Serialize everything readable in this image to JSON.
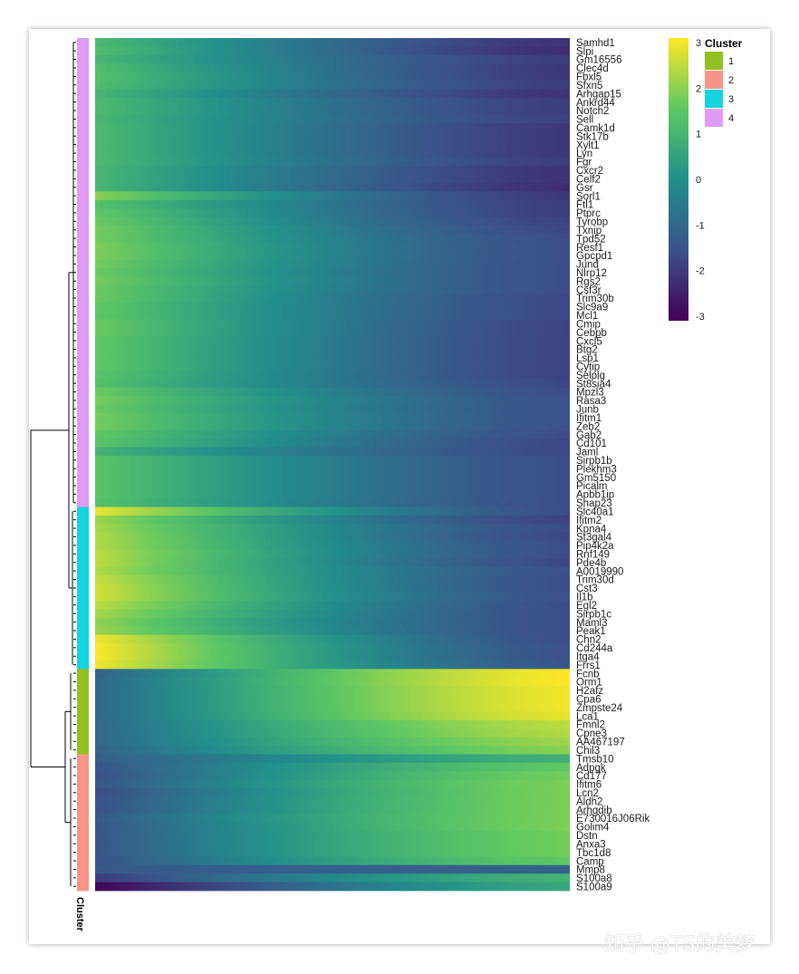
{
  "chart_data": {
    "type": "heatmap",
    "title": "",
    "xlabel": "",
    "ylabel": "",
    "colorbar": {
      "ticks": [
        "3",
        "2",
        "1",
        "0",
        "-1",
        "-2",
        "-3"
      ],
      "range": [
        -3,
        3
      ],
      "colors": [
        "#440154",
        "#3b528b",
        "#21908c",
        "#5dc863",
        "#fde725"
      ]
    },
    "cluster_legend": {
      "title": "Cluster",
      "entries": [
        {
          "label": "1",
          "color": "#93c01f"
        },
        {
          "label": "2",
          "color": "#f8938a"
        },
        {
          "label": "3",
          "color": "#13d4df"
        },
        {
          "label": "4",
          "color": "#df9cf2"
        }
      ]
    },
    "cluster_axis_label": "Cluster",
    "rows": [
      {
        "gene": "Samhd1",
        "cluster": "4",
        "start": 1.1,
        "end": -2.1
      },
      {
        "gene": "Slpi",
        "cluster": "4",
        "start": 1.2,
        "end": -2.2
      },
      {
        "gene": "Gm16556",
        "cluster": "4",
        "start": 1.0,
        "end": -1.9
      },
      {
        "gene": "Clec4d",
        "cluster": "4",
        "start": 1.2,
        "end": -2.0
      },
      {
        "gene": "Fbxl5",
        "cluster": "4",
        "start": 1.3,
        "end": -2.0
      },
      {
        "gene": "Sfxn5",
        "cluster": "4",
        "start": 1.2,
        "end": -1.9
      },
      {
        "gene": "Arhgap15",
        "cluster": "4",
        "start": 1.0,
        "end": -2.1
      },
      {
        "gene": "Ankrd44",
        "cluster": "4",
        "start": 1.1,
        "end": -1.9
      },
      {
        "gene": "Notch2",
        "cluster": "4",
        "start": 1.1,
        "end": -1.9
      },
      {
        "gene": "Sell",
        "cluster": "4",
        "start": 1.0,
        "end": -1.8
      },
      {
        "gene": "Camk1d",
        "cluster": "4",
        "start": 1.1,
        "end": -2.0
      },
      {
        "gene": "Stk17b",
        "cluster": "4",
        "start": 1.1,
        "end": -2.0
      },
      {
        "gene": "Xylt1",
        "cluster": "4",
        "start": 1.1,
        "end": -2.0
      },
      {
        "gene": "Lyn",
        "cluster": "4",
        "start": 1.1,
        "end": -2.0
      },
      {
        "gene": "Fgr",
        "cluster": "4",
        "start": 1.1,
        "end": -1.9
      },
      {
        "gene": "Cxcr2",
        "cluster": "4",
        "start": 1.0,
        "end": -2.1
      },
      {
        "gene": "Celf2",
        "cluster": "4",
        "start": 1.0,
        "end": -2.1
      },
      {
        "gene": "Gsr",
        "cluster": "4",
        "start": 1.0,
        "end": -2.2
      },
      {
        "gene": "Sorl1",
        "cluster": "4",
        "start": 1.9,
        "end": -2.0
      },
      {
        "gene": "Ftl1",
        "cluster": "4",
        "start": 1.3,
        "end": -1.9
      },
      {
        "gene": "Ptprc",
        "cluster": "4",
        "start": 1.5,
        "end": -1.9
      },
      {
        "gene": "Tyrobp",
        "cluster": "4",
        "start": 1.6,
        "end": -1.8
      },
      {
        "gene": "Txnip",
        "cluster": "4",
        "start": 1.7,
        "end": -1.7
      },
      {
        "gene": "Tpd52",
        "cluster": "4",
        "start": 1.7,
        "end": -1.6
      },
      {
        "gene": "Resf1",
        "cluster": "4",
        "start": 1.8,
        "end": -1.6
      },
      {
        "gene": "Gpcpd1",
        "cluster": "4",
        "start": 1.8,
        "end": -1.6
      },
      {
        "gene": "Jund",
        "cluster": "4",
        "start": 1.7,
        "end": -1.6
      },
      {
        "gene": "Nlrp12",
        "cluster": "4",
        "start": 1.6,
        "end": -1.6
      },
      {
        "gene": "Rgs2",
        "cluster": "4",
        "start": 1.7,
        "end": -1.6
      },
      {
        "gene": "Csf3r",
        "cluster": "4",
        "start": 1.6,
        "end": -1.6
      },
      {
        "gene": "Trim30b",
        "cluster": "4",
        "start": 1.6,
        "end": -1.7
      },
      {
        "gene": "Slc9a9",
        "cluster": "4",
        "start": 1.5,
        "end": -1.7
      },
      {
        "gene": "Mcl1",
        "cluster": "4",
        "start": 1.5,
        "end": -1.7
      },
      {
        "gene": "Cmip",
        "cluster": "4",
        "start": 1.6,
        "end": -1.8
      },
      {
        "gene": "Cebpb",
        "cluster": "4",
        "start": 1.6,
        "end": -1.8
      },
      {
        "gene": "Cxcl5",
        "cluster": "4",
        "start": 1.5,
        "end": -1.8
      },
      {
        "gene": "Btg2",
        "cluster": "4",
        "start": 1.5,
        "end": -1.8
      },
      {
        "gene": "Lsp1",
        "cluster": "4",
        "start": 1.5,
        "end": -1.8
      },
      {
        "gene": "Cytip",
        "cluster": "4",
        "start": 1.5,
        "end": -1.8
      },
      {
        "gene": "Selplg",
        "cluster": "4",
        "start": 1.4,
        "end": -1.8
      },
      {
        "gene": "St8sia4",
        "cluster": "4",
        "start": 1.3,
        "end": -1.7
      },
      {
        "gene": "Mpzl3",
        "cluster": "4",
        "start": 1.6,
        "end": -1.6
      },
      {
        "gene": "Rasa3",
        "cluster": "4",
        "start": 1.7,
        "end": -1.5
      },
      {
        "gene": "Junb",
        "cluster": "4",
        "start": 1.6,
        "end": -1.5
      },
      {
        "gene": "Ifitm1",
        "cluster": "4",
        "start": 1.7,
        "end": -1.5
      },
      {
        "gene": "Zeb2",
        "cluster": "4",
        "start": 1.7,
        "end": -1.5
      },
      {
        "gene": "Gab2",
        "cluster": "4",
        "start": 1.5,
        "end": -1.6
      },
      {
        "gene": "Cd101",
        "cluster": "4",
        "start": 1.4,
        "end": -1.7
      },
      {
        "gene": "Jaml",
        "cluster": "4",
        "start": 0.9,
        "end": -1.7
      },
      {
        "gene": "Sirpb1b",
        "cluster": "4",
        "start": 1.4,
        "end": -1.6
      },
      {
        "gene": "Plekhm3",
        "cluster": "4",
        "start": 1.4,
        "end": -1.6
      },
      {
        "gene": "Gm5150",
        "cluster": "4",
        "start": 1.4,
        "end": -1.6
      },
      {
        "gene": "Picalm",
        "cluster": "4",
        "start": 1.4,
        "end": -1.6
      },
      {
        "gene": "Apbb1ip",
        "cluster": "4",
        "start": 1.4,
        "end": -1.6
      },
      {
        "gene": "Shap23",
        "cluster": "4",
        "start": 1.3,
        "end": -1.6
      },
      {
        "gene": "Slc40a1",
        "cluster": "3",
        "start": 2.8,
        "end": -1.6
      },
      {
        "gene": "Ifitm2",
        "cluster": "3",
        "start": 2.1,
        "end": -1.8
      },
      {
        "gene": "Kpna4",
        "cluster": "3",
        "start": 2.2,
        "end": -1.6
      },
      {
        "gene": "St3gal4",
        "cluster": "3",
        "start": 2.3,
        "end": -1.7
      },
      {
        "gene": "Pip4k2a",
        "cluster": "3",
        "start": 2.3,
        "end": -1.6
      },
      {
        "gene": "Rnf149",
        "cluster": "3",
        "start": 2.4,
        "end": -1.6
      },
      {
        "gene": "Pde4b",
        "cluster": "3",
        "start": 2.4,
        "end": -1.7
      },
      {
        "gene": "A0019990",
        "cluster": "3",
        "start": 2.3,
        "end": -1.5
      },
      {
        "gene": "Trim30d",
        "cluster": "3",
        "start": 2.5,
        "end": -1.6
      },
      {
        "gene": "Cst3",
        "cluster": "3",
        "start": 2.6,
        "end": -1.6
      },
      {
        "gene": "Il1b",
        "cluster": "3",
        "start": 2.6,
        "end": -1.5
      },
      {
        "gene": "Egl2",
        "cluster": "3",
        "start": 2.4,
        "end": -1.6
      },
      {
        "gene": "Sirpb1c",
        "cluster": "3",
        "start": 2.2,
        "end": -1.6
      },
      {
        "gene": "Maml3",
        "cluster": "3",
        "start": 2.0,
        "end": -1.6
      },
      {
        "gene": "Peak1",
        "cluster": "3",
        "start": 2.1,
        "end": -1.6
      },
      {
        "gene": "Chn2",
        "cluster": "3",
        "start": 2.9,
        "end": -1.6
      },
      {
        "gene": "Cd244a",
        "cluster": "3",
        "start": 3.0,
        "end": -1.5
      },
      {
        "gene": "Itga4",
        "cluster": "3",
        "start": 3.0,
        "end": -1.5
      },
      {
        "gene": "Frrs1",
        "cluster": "3",
        "start": 2.9,
        "end": -1.4
      },
      {
        "gene": "Fcnb",
        "cluster": "1",
        "start": -1.1,
        "end": 3.0
      },
      {
        "gene": "Orm1",
        "cluster": "1",
        "start": -1.0,
        "end": 3.0
      },
      {
        "gene": "H2afz",
        "cluster": "1",
        "start": -1.0,
        "end": 2.9
      },
      {
        "gene": "Cpa6",
        "cluster": "1",
        "start": -1.0,
        "end": 2.9
      },
      {
        "gene": "Zmpste24",
        "cluster": "1",
        "start": -1.0,
        "end": 2.9
      },
      {
        "gene": "Lca1",
        "cluster": "1",
        "start": -1.0,
        "end": 2.8
      },
      {
        "gene": "Fmnl2",
        "cluster": "1",
        "start": -1.0,
        "end": 2.4
      },
      {
        "gene": "Cpne3",
        "cluster": "1",
        "start": -1.0,
        "end": 2.3
      },
      {
        "gene": "AA467197",
        "cluster": "1",
        "start": -1.0,
        "end": 2.1
      },
      {
        "gene": "Chil3",
        "cluster": "1",
        "start": -1.1,
        "end": 1.9
      },
      {
        "gene": "Tmsb10",
        "cluster": "2",
        "start": -1.2,
        "end": 0.8
      },
      {
        "gene": "Adpgk",
        "cluster": "2",
        "start": -1.4,
        "end": 1.5
      },
      {
        "gene": "Cd177",
        "cluster": "2",
        "start": -1.5,
        "end": 1.7
      },
      {
        "gene": "Ifitm6",
        "cluster": "2",
        "start": -1.4,
        "end": 1.8
      },
      {
        "gene": "Lcn2",
        "cluster": "2",
        "start": -1.6,
        "end": 1.8
      },
      {
        "gene": "Aldh2",
        "cluster": "2",
        "start": -1.5,
        "end": 1.8
      },
      {
        "gene": "Arhgdib",
        "cluster": "2",
        "start": -1.5,
        "end": 1.8
      },
      {
        "gene": "E730016J06Rik",
        "cluster": "2",
        "start": -1.3,
        "end": 1.8
      },
      {
        "gene": "Golim4",
        "cluster": "2",
        "start": -1.4,
        "end": 1.8
      },
      {
        "gene": "Dstn",
        "cluster": "2",
        "start": -1.4,
        "end": 1.7
      },
      {
        "gene": "Anxa3",
        "cluster": "2",
        "start": -1.4,
        "end": 1.7
      },
      {
        "gene": "Tbc1d8",
        "cluster": "2",
        "start": -1.4,
        "end": 1.7
      },
      {
        "gene": "Camp",
        "cluster": "2",
        "start": -1.5,
        "end": 1.5
      },
      {
        "gene": "Mmp8",
        "cluster": "2",
        "start": -1.3,
        "end": -1.1
      },
      {
        "gene": "S100a8",
        "cluster": "2",
        "start": -1.9,
        "end": 0.9
      },
      {
        "gene": "S100a9",
        "cluster": "2",
        "start": -2.9,
        "end": 0.6
      }
    ]
  },
  "watermark": "知乎 @TS的美梦"
}
